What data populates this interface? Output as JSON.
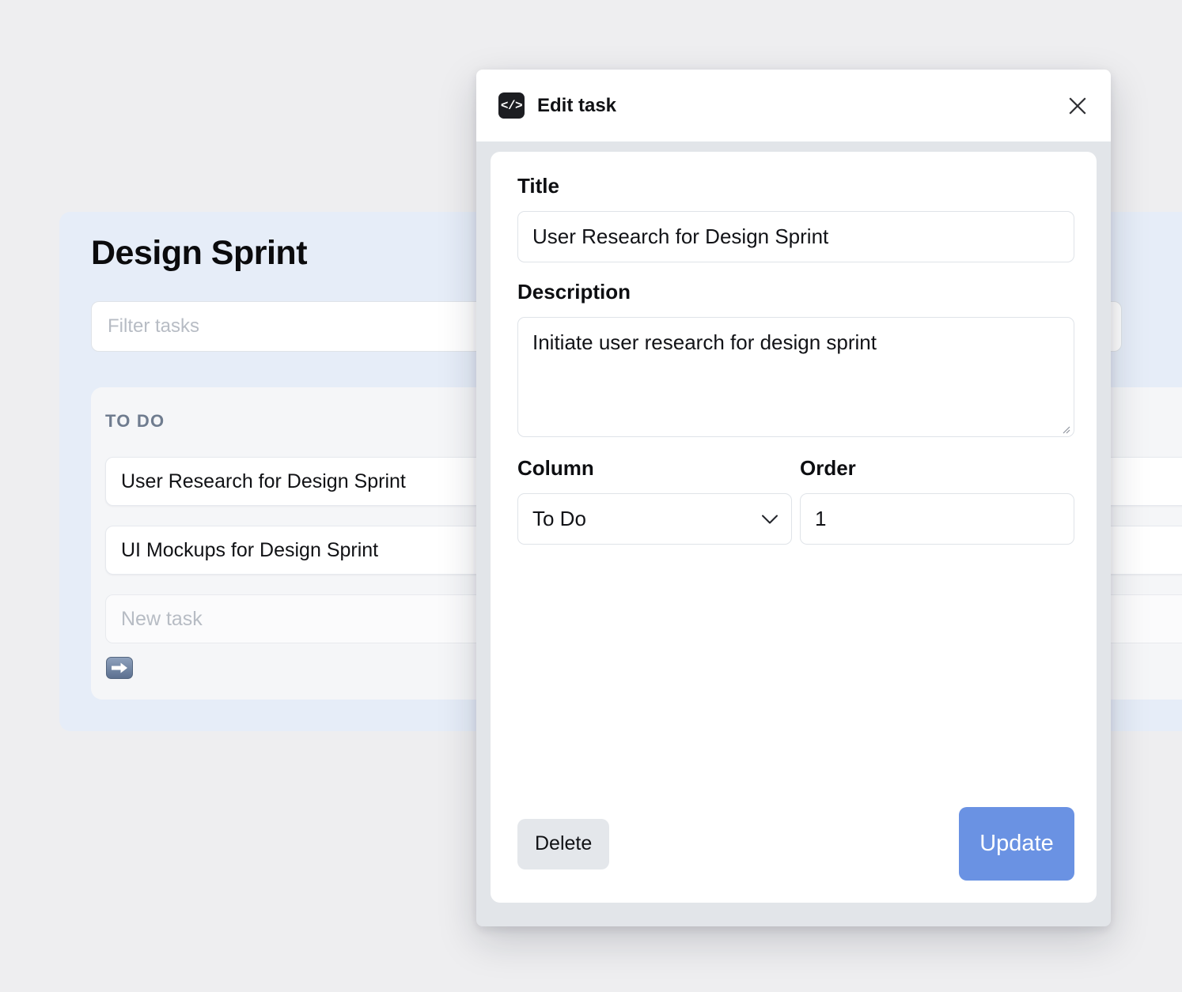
{
  "board": {
    "title": "Design Sprint",
    "filter_placeholder": "Filter tasks",
    "column": {
      "heading": "TO DO",
      "tasks": [
        {
          "title": "User Research for Design Sprint"
        },
        {
          "title": "UI Mockups for Design Sprint"
        }
      ],
      "new_task_placeholder": "New task",
      "add_button_icon": "right-arrow-emoji-icon"
    }
  },
  "modal": {
    "brand_icon": "code-brackets-icon",
    "brand_glyph": "</>",
    "title": "Edit task",
    "close_icon": "close-icon",
    "fields": {
      "title_label": "Title",
      "title_value": "User Research for Design Sprint",
      "description_label": "Description",
      "description_value": "Initiate user research for design sprint",
      "column_label": "Column",
      "column_value": "To Do",
      "column_options": [
        "To Do"
      ],
      "order_label": "Order",
      "order_value": "1"
    },
    "footer": {
      "delete_label": "Delete",
      "update_label": "Update"
    }
  },
  "colors": {
    "page_background": "#eeeef0",
    "board_background": "#e6edf8",
    "column_background": "#f5f6f8",
    "modal_background": "#e2e5e9",
    "primary_button": "#6a92e3",
    "secondary_button": "#e4e7eb",
    "brand_badge": "#1c1d21"
  }
}
